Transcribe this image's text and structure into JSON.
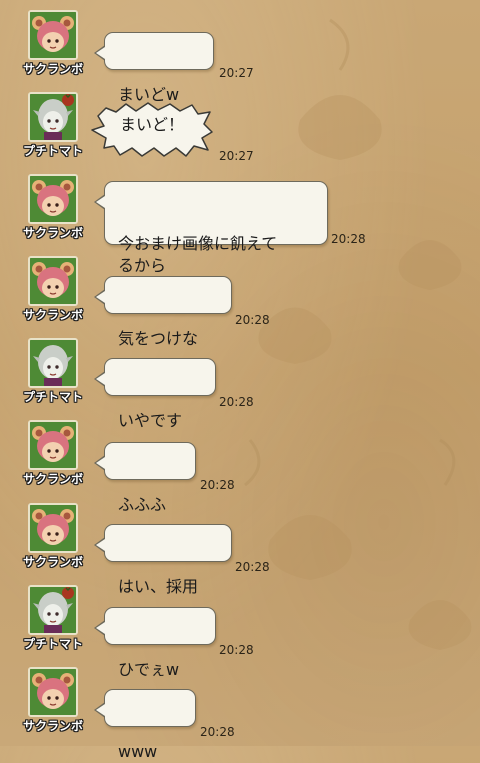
{
  "messages": [
    {
      "sender": "サクランボ",
      "text": "まいどw",
      "time": "20:27",
      "avatar": "sakuranbo-avatar"
    },
    {
      "sender": "プチトマト",
      "text": "まいど！",
      "time": "20:27",
      "avatar": "puchitomato-avatar",
      "style": "shout"
    },
    {
      "sender": "サクランボ",
      "text": "今おまけ画像に飢えて\nるから",
      "time": "20:28",
      "avatar": "sakuranbo-avatar"
    },
    {
      "sender": "サクランボ",
      "text": "気をつけな",
      "time": "20:28",
      "avatar": "sakuranbo-avatar"
    },
    {
      "sender": "プチトマト",
      "text": "いやです",
      "time": "20:28",
      "avatar": "puchitomato-avatar"
    },
    {
      "sender": "サクランボ",
      "text": "ふふふ",
      "time": "20:28",
      "avatar": "sakuranbo-avatar"
    },
    {
      "sender": "サクランボ",
      "text": "はい、採用",
      "time": "20:28",
      "avatar": "sakuranbo-avatar"
    },
    {
      "sender": "プチトマト",
      "text": "ひでぇw",
      "time": "20:28",
      "avatar": "puchitomato-avatar"
    },
    {
      "sender": "サクランボ",
      "text": "www",
      "time": "20:28",
      "avatar": "sakuranbo-avatar"
    }
  ],
  "colors": {
    "background": "#c7a473",
    "bubble": "#f7f5ec",
    "bubble_border": "#6e6a5c",
    "avatar_bg": "#3f7a2e"
  }
}
